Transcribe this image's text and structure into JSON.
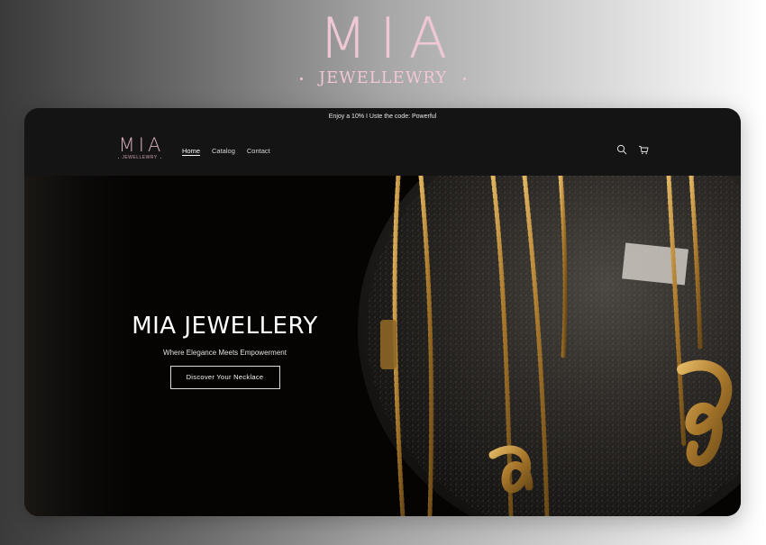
{
  "brand": {
    "mark": "MIA",
    "sub": "JEWELLEWRY",
    "color": "#f0c8d3"
  },
  "announcement": "Enjoy a 10% I Uste the code: Powerful",
  "header": {
    "logo_mark": "MIA",
    "logo_sub": "JEWELLEWRY",
    "nav": [
      {
        "label": "Home",
        "active": true
      },
      {
        "label": "Catalog",
        "active": false
      },
      {
        "label": "Contact",
        "active": false
      }
    ],
    "icons": [
      "search-icon",
      "cart-icon"
    ]
  },
  "hero": {
    "title": "MIA JEWELLERY",
    "subtitle": "Where Elegance Meets Empowerment",
    "cta": "Discover Your Necklace"
  },
  "colors": {
    "accent_pink": "#f0c8d3",
    "site_bg": "#141414",
    "gold": "#b8893a"
  }
}
